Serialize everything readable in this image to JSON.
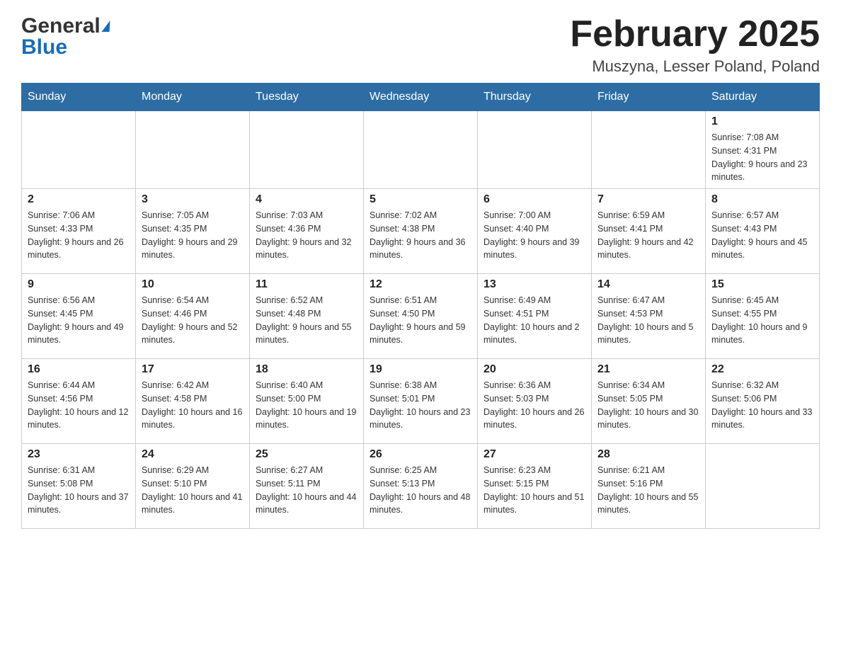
{
  "header": {
    "logo_general": "General",
    "logo_blue": "Blue",
    "title": "February 2025",
    "subtitle": "Muszyna, Lesser Poland, Poland"
  },
  "weekdays": [
    "Sunday",
    "Monday",
    "Tuesday",
    "Wednesday",
    "Thursday",
    "Friday",
    "Saturday"
  ],
  "weeks": [
    [
      {
        "day": "",
        "info": ""
      },
      {
        "day": "",
        "info": ""
      },
      {
        "day": "",
        "info": ""
      },
      {
        "day": "",
        "info": ""
      },
      {
        "day": "",
        "info": ""
      },
      {
        "day": "",
        "info": ""
      },
      {
        "day": "1",
        "info": "Sunrise: 7:08 AM\nSunset: 4:31 PM\nDaylight: 9 hours and 23 minutes."
      }
    ],
    [
      {
        "day": "2",
        "info": "Sunrise: 7:06 AM\nSunset: 4:33 PM\nDaylight: 9 hours and 26 minutes."
      },
      {
        "day": "3",
        "info": "Sunrise: 7:05 AM\nSunset: 4:35 PM\nDaylight: 9 hours and 29 minutes."
      },
      {
        "day": "4",
        "info": "Sunrise: 7:03 AM\nSunset: 4:36 PM\nDaylight: 9 hours and 32 minutes."
      },
      {
        "day": "5",
        "info": "Sunrise: 7:02 AM\nSunset: 4:38 PM\nDaylight: 9 hours and 36 minutes."
      },
      {
        "day": "6",
        "info": "Sunrise: 7:00 AM\nSunset: 4:40 PM\nDaylight: 9 hours and 39 minutes."
      },
      {
        "day": "7",
        "info": "Sunrise: 6:59 AM\nSunset: 4:41 PM\nDaylight: 9 hours and 42 minutes."
      },
      {
        "day": "8",
        "info": "Sunrise: 6:57 AM\nSunset: 4:43 PM\nDaylight: 9 hours and 45 minutes."
      }
    ],
    [
      {
        "day": "9",
        "info": "Sunrise: 6:56 AM\nSunset: 4:45 PM\nDaylight: 9 hours and 49 minutes."
      },
      {
        "day": "10",
        "info": "Sunrise: 6:54 AM\nSunset: 4:46 PM\nDaylight: 9 hours and 52 minutes."
      },
      {
        "day": "11",
        "info": "Sunrise: 6:52 AM\nSunset: 4:48 PM\nDaylight: 9 hours and 55 minutes."
      },
      {
        "day": "12",
        "info": "Sunrise: 6:51 AM\nSunset: 4:50 PM\nDaylight: 9 hours and 59 minutes."
      },
      {
        "day": "13",
        "info": "Sunrise: 6:49 AM\nSunset: 4:51 PM\nDaylight: 10 hours and 2 minutes."
      },
      {
        "day": "14",
        "info": "Sunrise: 6:47 AM\nSunset: 4:53 PM\nDaylight: 10 hours and 5 minutes."
      },
      {
        "day": "15",
        "info": "Sunrise: 6:45 AM\nSunset: 4:55 PM\nDaylight: 10 hours and 9 minutes."
      }
    ],
    [
      {
        "day": "16",
        "info": "Sunrise: 6:44 AM\nSunset: 4:56 PM\nDaylight: 10 hours and 12 minutes."
      },
      {
        "day": "17",
        "info": "Sunrise: 6:42 AM\nSunset: 4:58 PM\nDaylight: 10 hours and 16 minutes."
      },
      {
        "day": "18",
        "info": "Sunrise: 6:40 AM\nSunset: 5:00 PM\nDaylight: 10 hours and 19 minutes."
      },
      {
        "day": "19",
        "info": "Sunrise: 6:38 AM\nSunset: 5:01 PM\nDaylight: 10 hours and 23 minutes."
      },
      {
        "day": "20",
        "info": "Sunrise: 6:36 AM\nSunset: 5:03 PM\nDaylight: 10 hours and 26 minutes."
      },
      {
        "day": "21",
        "info": "Sunrise: 6:34 AM\nSunset: 5:05 PM\nDaylight: 10 hours and 30 minutes."
      },
      {
        "day": "22",
        "info": "Sunrise: 6:32 AM\nSunset: 5:06 PM\nDaylight: 10 hours and 33 minutes."
      }
    ],
    [
      {
        "day": "23",
        "info": "Sunrise: 6:31 AM\nSunset: 5:08 PM\nDaylight: 10 hours and 37 minutes."
      },
      {
        "day": "24",
        "info": "Sunrise: 6:29 AM\nSunset: 5:10 PM\nDaylight: 10 hours and 41 minutes."
      },
      {
        "day": "25",
        "info": "Sunrise: 6:27 AM\nSunset: 5:11 PM\nDaylight: 10 hours and 44 minutes."
      },
      {
        "day": "26",
        "info": "Sunrise: 6:25 AM\nSunset: 5:13 PM\nDaylight: 10 hours and 48 minutes."
      },
      {
        "day": "27",
        "info": "Sunrise: 6:23 AM\nSunset: 5:15 PM\nDaylight: 10 hours and 51 minutes."
      },
      {
        "day": "28",
        "info": "Sunrise: 6:21 AM\nSunset: 5:16 PM\nDaylight: 10 hours and 55 minutes."
      },
      {
        "day": "",
        "info": ""
      }
    ]
  ]
}
